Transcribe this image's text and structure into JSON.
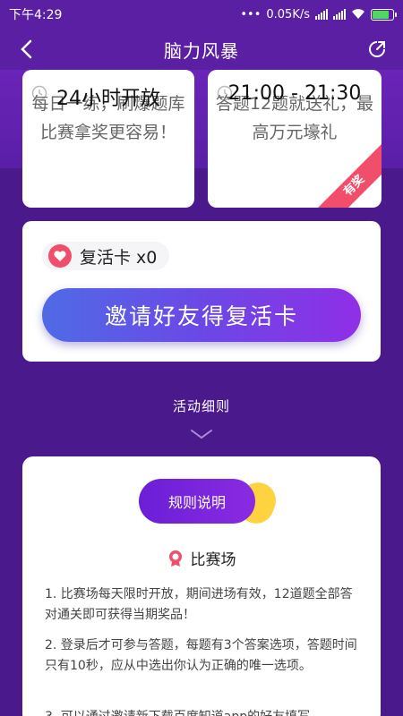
{
  "status_bar": {
    "time": "下午4:29",
    "network_speed": "0.05K/s",
    "battery_color": "#4cd964"
  },
  "header": {
    "title": "脑力风暴",
    "background": "#5b1fa3"
  },
  "modes": [
    {
      "time_label": "24小时开放",
      "description": "每日一练，刷爆题库\n比赛拿奖更容易！"
    },
    {
      "time_label": "21:00 - 21:30",
      "description": "答题12题就送礼，最高万元壕礼",
      "ribbon": "有奖"
    }
  ],
  "revive": {
    "chip_label": "复活卡 x0",
    "invite_button": "邀请好友得复活卡"
  },
  "rules_section": {
    "heading": "活动细则",
    "button_label": "规则说明",
    "arena_title": "比赛场",
    "rules": [
      "1. 比赛场每天限时开放，期间进场有效，12道题全部答对通关即可获得当期奖品！",
      "2. 登录后才可参与答题，每题有3个答案选项，答题时间只有10秒，应从中选出你认为正确的唯一选项。",
      "3. 可以通过邀请新下载百度知道app的好友填写"
    ]
  },
  "colors": {
    "page_bg": "#4a1a8c",
    "accent_pink": "#f04e6a",
    "accent_yellow": "#ffd23f"
  }
}
